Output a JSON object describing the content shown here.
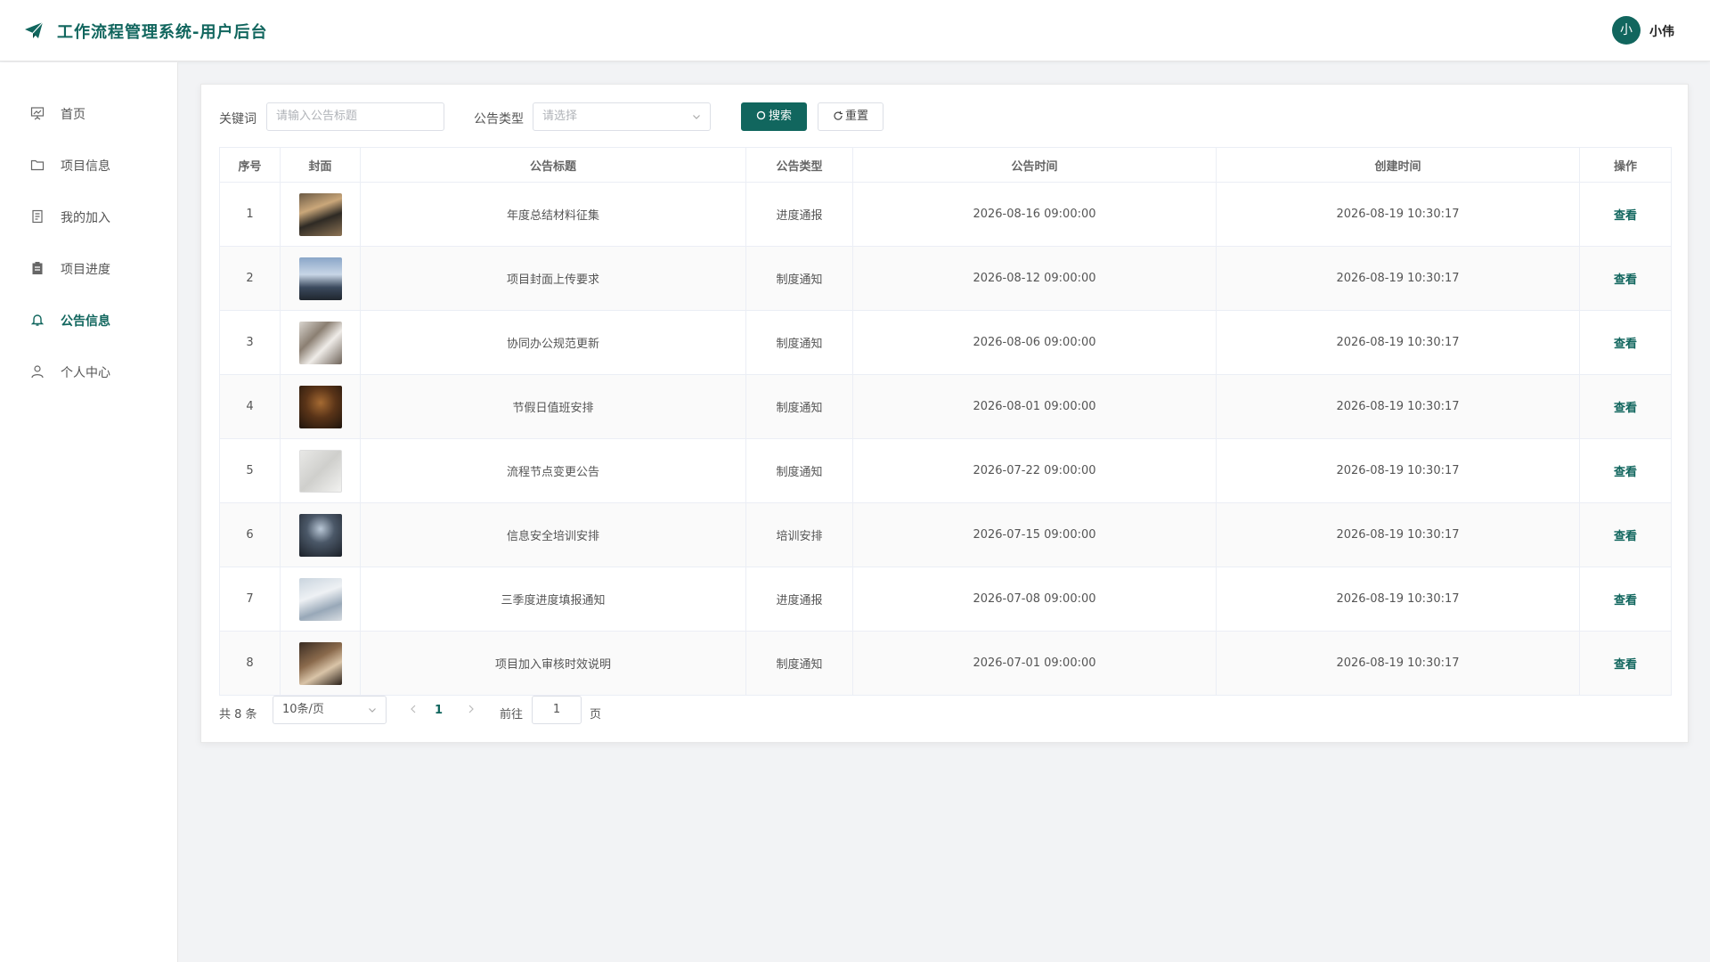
{
  "header": {
    "title": "工作流程管理系统-用户后台",
    "avatar_initial": "小",
    "username": "小伟",
    "accent": "#11665e"
  },
  "sidebar": {
    "items": [
      {
        "label": "首页",
        "icon": "presentation-icon",
        "active": false
      },
      {
        "label": "项目信息",
        "icon": "folder-icon",
        "active": false
      },
      {
        "label": "我的加入",
        "icon": "document-icon",
        "active": false
      },
      {
        "label": "项目进度",
        "icon": "clipboard-icon",
        "active": false
      },
      {
        "label": "公告信息",
        "icon": "bell-icon",
        "active": true
      },
      {
        "label": "个人中心",
        "icon": "user-icon",
        "active": false
      }
    ]
  },
  "search": {
    "keyword_label": "关键词",
    "keyword_placeholder": "请输入公告标题",
    "type_label": "公告类型",
    "type_placeholder": "请选择",
    "search_button": "搜索",
    "reset_button": "重置"
  },
  "table": {
    "columns": [
      "序号",
      "封面",
      "公告标题",
      "公告类型",
      "公告时间",
      "创建时间",
      "操作"
    ],
    "action_label": "查看",
    "rows": [
      {
        "index": "1",
        "title": "年度总结材料征集",
        "type": "进度通报",
        "notice_time": "2026-08-16 09:00:00",
        "created_time": "2026-08-19 10:30:17",
        "cover": "stacked-documents"
      },
      {
        "index": "2",
        "title": "项目封面上传要求",
        "type": "制度通知",
        "notice_time": "2026-08-12 09:00:00",
        "created_time": "2026-08-19 10:30:17",
        "cover": "office-building"
      },
      {
        "index": "3",
        "title": "协同办公规范更新",
        "type": "制度通知",
        "notice_time": "2026-08-06 09:00:00",
        "created_time": "2026-08-19 10:30:17",
        "cover": "team-meeting"
      },
      {
        "index": "4",
        "title": "节假日值班安排",
        "type": "制度通知",
        "notice_time": "2026-08-01 09:00:00",
        "created_time": "2026-08-19 10:30:17",
        "cover": "dark-office"
      },
      {
        "index": "5",
        "title": "流程节点变更公告",
        "type": "制度通知",
        "notice_time": "2026-07-22 09:00:00",
        "created_time": "2026-08-19 10:30:17",
        "cover": "whiteboard"
      },
      {
        "index": "6",
        "title": "信息安全培训安排",
        "type": "培训安排",
        "notice_time": "2026-07-15 09:00:00",
        "created_time": "2026-08-19 10:30:17",
        "cover": "training-room"
      },
      {
        "index": "7",
        "title": "三季度进度填报通知",
        "type": "进度通报",
        "notice_time": "2026-07-08 09:00:00",
        "created_time": "2026-08-19 10:30:17",
        "cover": "desk-papers"
      },
      {
        "index": "8",
        "title": "项目加入审核时效说明",
        "type": "制度通知",
        "notice_time": "2026-07-01 09:00:00",
        "created_time": "2026-08-19 10:30:17",
        "cover": "gavel"
      }
    ]
  },
  "pagination": {
    "total": "共 8 条",
    "page_size": "10条/页",
    "current_page": "1",
    "goto_label": "前往",
    "goto_value": "1",
    "page_unit": "页"
  }
}
